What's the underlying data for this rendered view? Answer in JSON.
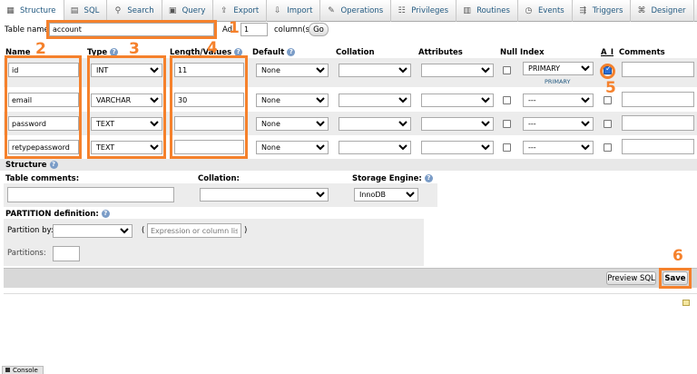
{
  "tabs": [
    {
      "label": "Structure",
      "icon": "structure-icon",
      "glyph": "▦"
    },
    {
      "label": "SQL",
      "icon": "sql-icon",
      "glyph": "▤"
    },
    {
      "label": "Search",
      "icon": "search-icon",
      "glyph": "⚲"
    },
    {
      "label": "Query",
      "icon": "query-icon",
      "glyph": "▣"
    },
    {
      "label": "Export",
      "icon": "export-icon",
      "glyph": "⇪"
    },
    {
      "label": "Import",
      "icon": "import-icon",
      "glyph": "⇩"
    },
    {
      "label": "Operations",
      "icon": "operations-icon",
      "glyph": "✎"
    },
    {
      "label": "Privileges",
      "icon": "privileges-icon",
      "glyph": "☷"
    },
    {
      "label": "Routines",
      "icon": "routines-icon",
      "glyph": "▥"
    },
    {
      "label": "Events",
      "icon": "events-icon",
      "glyph": "◷"
    },
    {
      "label": "Triggers",
      "icon": "triggers-icon",
      "glyph": "⇶"
    },
    {
      "label": "Designer",
      "icon": "designer-icon",
      "glyph": "⌘"
    }
  ],
  "table_name": {
    "label": "Table name:",
    "value": "account"
  },
  "add": {
    "label": "Ad",
    "count": "1",
    "suffix": "column(s)",
    "go": "Go"
  },
  "headers": {
    "name": "Name",
    "type": "Type",
    "length": "Length/Values",
    "default": "Default",
    "collation": "Collation",
    "attributes": "Attributes",
    "null": "Null",
    "index": "Index",
    "ai": "A_I",
    "comments": "Comments"
  },
  "columns": [
    {
      "name": "id",
      "type": "INT",
      "length": "11",
      "default": "None",
      "index": "PRIMARY",
      "index_note": "PRIMARY",
      "ai": true
    },
    {
      "name": "email",
      "type": "VARCHAR",
      "length": "30",
      "default": "None",
      "index": "---",
      "index_note": "",
      "ai": false
    },
    {
      "name": "password",
      "type": "TEXT",
      "length": "",
      "default": "None",
      "index": "---",
      "index_note": "",
      "ai": false
    },
    {
      "name": "retypepassword",
      "type": "TEXT",
      "length": "",
      "default": "None",
      "index": "---",
      "index_note": "",
      "ai": false
    }
  ],
  "structure": {
    "title": "Structure",
    "table_comments": "Table comments:",
    "collation": "Collation:",
    "storage_engine": "Storage Engine:",
    "engine_value": "InnoDB"
  },
  "partition": {
    "title": "PARTITION definition:",
    "partition_by": "Partition by:",
    "open_paren": "(",
    "close_paren": ")",
    "expression_placeholder": "Expression or column list",
    "partitions": "Partitions:"
  },
  "buttons": {
    "preview": "Preview SQL",
    "save": "Save"
  },
  "console": "Console",
  "annotations": [
    "1",
    "2",
    "3",
    "4",
    "5",
    "6"
  ],
  "colors": {
    "accent": "#f5812c",
    "link": "#235a81",
    "row_alt": "#ececec"
  }
}
